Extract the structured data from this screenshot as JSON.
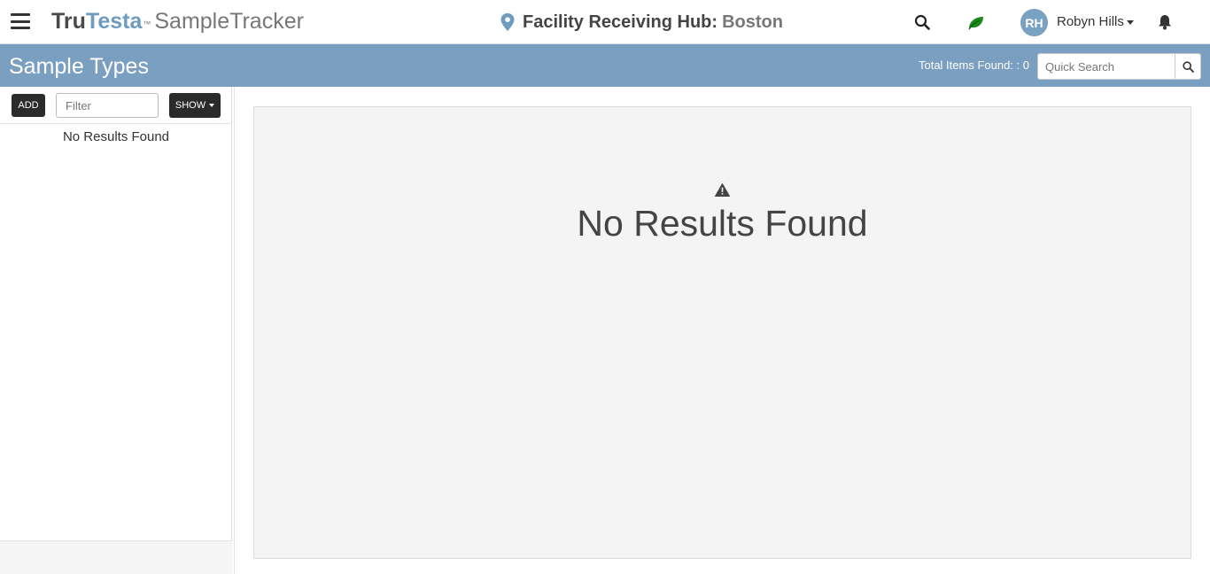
{
  "header": {
    "brand_tru": "Tru",
    "brand_testa": "Testa",
    "brand_tm": "™",
    "brand_app": "SampleTracker",
    "facility_label": "Facility Receiving Hub:",
    "facility_city": "Boston",
    "user_initials": "RH",
    "user_name": "Robyn Hills",
    "icons": [
      "menu-icon",
      "location-pin-icon",
      "search-icon",
      "leaf-icon",
      "caret-down-icon",
      "bell-icon"
    ]
  },
  "titlebar": {
    "title": "Sample Types",
    "total_items": "Total Items Found: : 0",
    "quick_search_placeholder": "Quick Search"
  },
  "sidebar": {
    "add_label": "ADD",
    "filter_placeholder": "Filter",
    "show_label": "SHOW",
    "empty_text": "No Results Found"
  },
  "main": {
    "empty_text": "No Results Found"
  },
  "colors": {
    "accent": "#7a9fc0",
    "brand_blue": "#6f9bbf",
    "leaf_green": "#1a8a1a",
    "dark_button": "#2b2b2b",
    "panel_bg": "#f4f4f4"
  }
}
